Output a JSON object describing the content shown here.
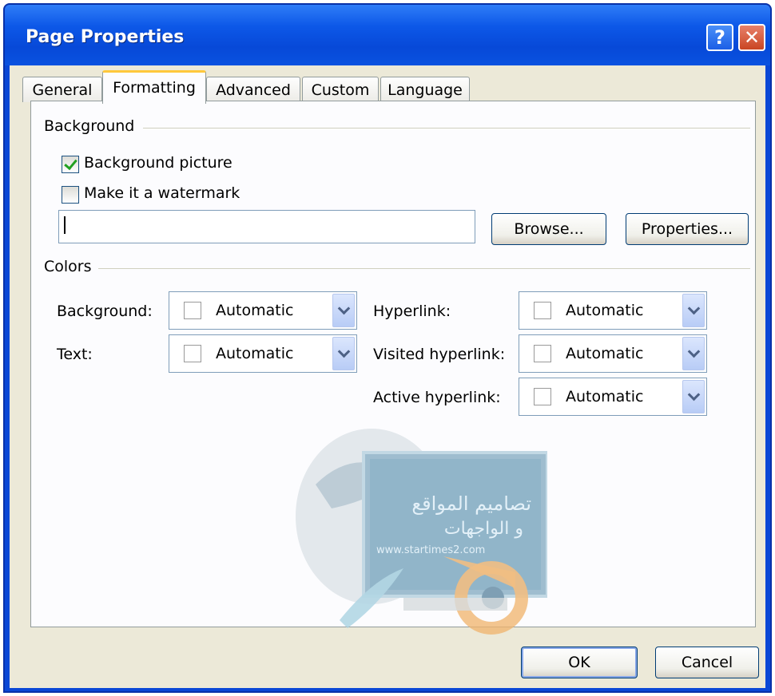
{
  "window": {
    "title": "Page Properties"
  },
  "tabs": [
    "General",
    "Formatting",
    "Advanced",
    "Custom",
    "Language"
  ],
  "background_group": {
    "label": "Background",
    "background_picture": {
      "label": "Background picture",
      "checked": true
    },
    "watermark": {
      "label": "Make it a watermark",
      "checked": false
    },
    "path_value": "",
    "browse_label": "Browse...",
    "properties_label": "Properties..."
  },
  "colors_group": {
    "label": "Colors",
    "fields": [
      {
        "label": "Background:",
        "value": "Automatic"
      },
      {
        "label": "Text:",
        "value": "Automatic"
      },
      {
        "label": "Hyperlink:",
        "value": "Automatic"
      },
      {
        "label": "Visited hyperlink:",
        "value": "Automatic"
      },
      {
        "label": "Active hyperlink:",
        "value": "Automatic"
      }
    ]
  },
  "watermark_logo": {
    "text_line1": "تصاميم المواقع",
    "text_line2": "و الواجهات",
    "url": "www.startimes2.com"
  },
  "footer": {
    "ok_label": "OK",
    "cancel_label": "Cancel"
  },
  "colors": {
    "title_blue": "#0a52e0",
    "face": "#ece9d8",
    "tab_highlight": "#ffc83c"
  }
}
